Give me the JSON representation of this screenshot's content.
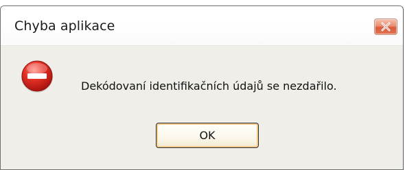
{
  "window": {
    "title": "Chyba aplikace",
    "close_icon": "close-x-icon"
  },
  "dialog": {
    "icon": "error-stop-icon",
    "message": "Dekódovaní identifikačních údajů se nezdařilo.",
    "ok_label": "OK"
  },
  "colors": {
    "error_red": "#d9281f",
    "close_red": "#e06a4c",
    "button_focus": "#f5c98a"
  }
}
